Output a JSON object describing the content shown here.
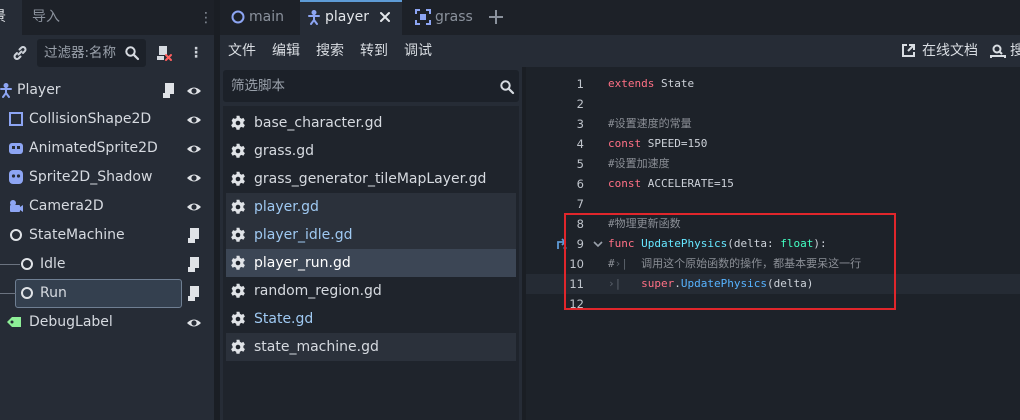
{
  "scene_dock": {
    "tabs": [
      "景",
      "导入"
    ],
    "filter_placeholder": "过滤器:名称",
    "nodes": [
      {
        "label": "Player",
        "icon": "character-body-icon",
        "script": true,
        "visible": true
      },
      {
        "label": "CollisionShape2D",
        "icon": "collision-shape-icon",
        "script": false,
        "visible": true
      },
      {
        "label": "AnimatedSprite2D",
        "icon": "animated-sprite-icon",
        "script": false,
        "visible": true
      },
      {
        "label": "Sprite2D_Shadow",
        "icon": "sprite-icon",
        "script": false,
        "visible": true
      },
      {
        "label": "Camera2D",
        "icon": "camera-icon",
        "script": false,
        "visible": true
      },
      {
        "label": "StateMachine",
        "icon": "node-circle-icon",
        "script": true
      },
      {
        "label": "Idle",
        "icon": "node-circle-icon",
        "script": true
      },
      {
        "label": "Run",
        "icon": "node-circle-icon",
        "script": true
      },
      {
        "label": "DebugLabel",
        "icon": "label-icon",
        "script": false,
        "visible": true
      }
    ]
  },
  "script_tabs": [
    {
      "label": "main",
      "icon": "scene-icon"
    },
    {
      "label": "player",
      "icon": "character-body-icon"
    },
    {
      "label": "grass",
      "icon": "tilemap-icon"
    }
  ],
  "menu": {
    "items": [
      "文件",
      "编辑",
      "搜索",
      "转到",
      "调试"
    ],
    "online_docs": "在线文档",
    "search_help": "搜"
  },
  "script_panel": {
    "filter_placeholder": "筛选脚本",
    "scripts": [
      {
        "name": "base_character.gd",
        "color": "#d6dae0"
      },
      {
        "name": "grass.gd",
        "color": "#d6dae0"
      },
      {
        "name": "grass_generator_tileMapLayer.gd",
        "color": "#d6dae0"
      },
      {
        "name": "player.gd",
        "color": "#9fc9f2"
      },
      {
        "name": "player_idle.gd",
        "color": "#9fc9f2"
      },
      {
        "name": "player_run.gd",
        "color": "#ffffff"
      },
      {
        "name": "random_region.gd",
        "color": "#d6dae0"
      },
      {
        "name": "State.gd",
        "color": "#9fc9f2"
      },
      {
        "name": "state_machine.gd",
        "color": "#d6dae0"
      }
    ],
    "selected": "player_run.gd"
  },
  "editor": {
    "lines": [
      {
        "n": "1",
        "tokens": [
          [
            "kw",
            "extends"
          ],
          [
            "id",
            " State"
          ]
        ]
      },
      {
        "n": "2",
        "tokens": []
      },
      {
        "n": "3",
        "tokens": [
          [
            "cm",
            "#设置速度的常量"
          ]
        ]
      },
      {
        "n": "4",
        "tokens": [
          [
            "kw",
            "const"
          ],
          [
            "id",
            " SPEED=150"
          ]
        ]
      },
      {
        "n": "5",
        "tokens": [
          [
            "cm",
            "#设置加速度"
          ]
        ]
      },
      {
        "n": "6",
        "tokens": [
          [
            "kw",
            "const"
          ],
          [
            "id",
            " ACCELERATE=15"
          ]
        ]
      },
      {
        "n": "7",
        "tokens": []
      },
      {
        "n": "8",
        "tokens": [
          [
            "cm",
            "#物理更新函数"
          ]
        ]
      },
      {
        "n": "9",
        "tokens": [
          [
            "kw",
            "func"
          ],
          [
            "id",
            " "
          ],
          [
            "fn",
            "UpdatePhysics"
          ],
          [
            "id",
            "(delta: "
          ],
          [
            "ty",
            "float"
          ],
          [
            "id",
            "):"
          ]
        ]
      },
      {
        "n": "10",
        "tokens": [
          [
            "cm",
            "#"
          ],
          [
            "tabmark",
            "›|"
          ],
          [
            "cm",
            "  调用这个原始函数的操作，都基本要呆这一行"
          ]
        ]
      },
      {
        "n": "11",
        "tokens": [
          [
            "tabmark",
            "›|"
          ],
          [
            "id",
            "   "
          ],
          [
            "kw",
            "super"
          ],
          [
            "id",
            "."
          ],
          [
            "fn2",
            "UpdatePhysics"
          ],
          [
            "id",
            "(delta)"
          ]
        ]
      },
      {
        "n": "12",
        "tokens": []
      }
    ],
    "current_line": "11"
  }
}
